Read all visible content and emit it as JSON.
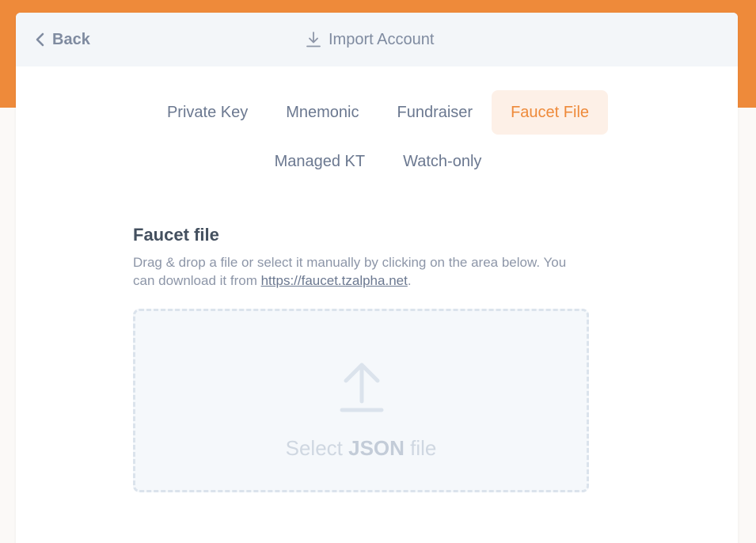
{
  "header": {
    "back_label": "Back",
    "title": "Import Account"
  },
  "tabs": [
    {
      "label": "Private Key",
      "active": false
    },
    {
      "label": "Mnemonic",
      "active": false
    },
    {
      "label": "Fundraiser",
      "active": false
    },
    {
      "label": "Faucet File",
      "active": true
    },
    {
      "label": "Managed KT",
      "active": false
    },
    {
      "label": "Watch-only",
      "active": false
    }
  ],
  "faucet": {
    "title": "Faucet file",
    "desc_before": "Drag & drop a file or select it manually by clicking on the area below. You can download it from ",
    "link": "https://faucet.tzalpha.net",
    "desc_after": ".",
    "drop_prefix": "Select ",
    "drop_bold": "JSON",
    "drop_suffix": " file"
  },
  "colors": {
    "accent": "#ee8a3a",
    "active_tab_bg": "#fdf0e7",
    "text_muted": "#7f8ba0"
  },
  "icons": {
    "back": "chevron-left-icon",
    "title": "download-icon",
    "dropzone": "upload-arrow-icon"
  }
}
